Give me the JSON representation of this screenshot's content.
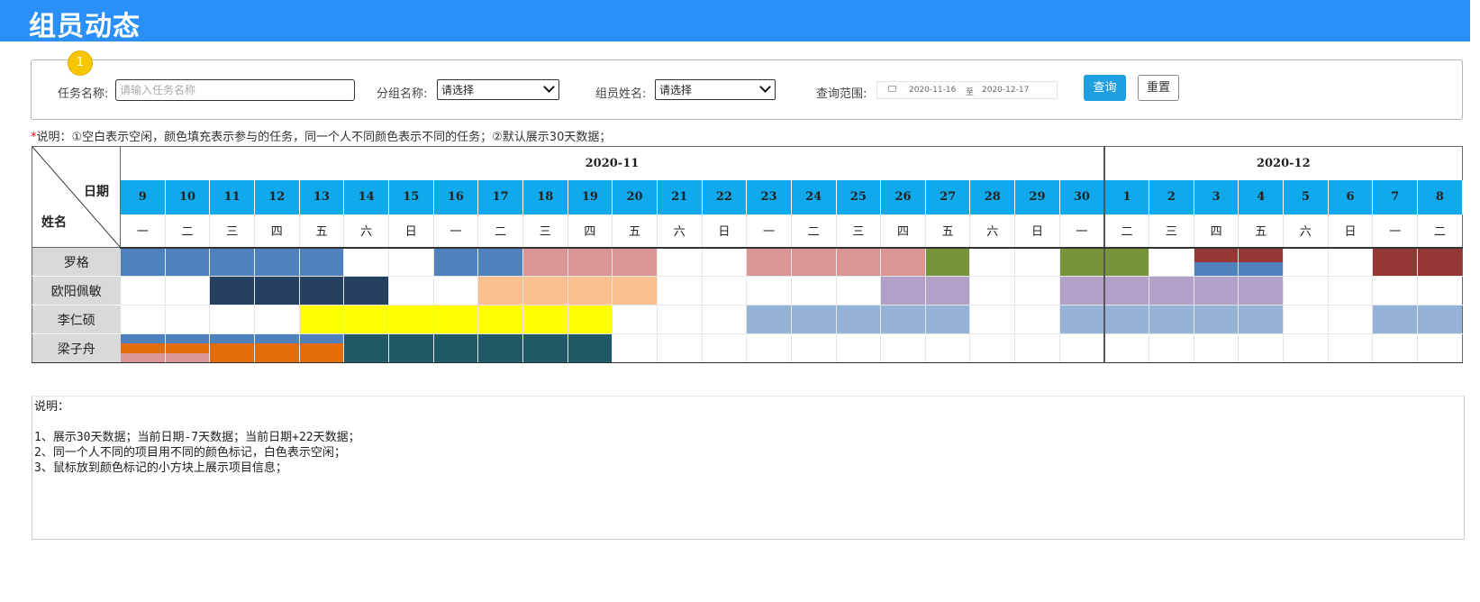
{
  "header": {
    "title": "组员动态"
  },
  "filters": {
    "badge": "1",
    "task_label": "任务名称:",
    "task_placeholder": "请输入任务名称",
    "group_label": "分组名称:",
    "group_value": "请选择",
    "member_label": "组员姓名:",
    "member_value": "请选择",
    "range_label": "查询范围:",
    "range_start": "2020-11-16",
    "range_sep": "至",
    "range_end": "2020-12-17",
    "query_label": "查询",
    "reset_label": "重置"
  },
  "note": {
    "star": "*",
    "text": "说明：①空白表示空闲，颜色填充表示参与的任务，同一个人不同颜色表示不同的任务；②默认展示30天数据；"
  },
  "grid": {
    "corner_date": "日期",
    "corner_name": "姓名",
    "months": [
      {
        "label": "2020-11",
        "span": 22
      },
      {
        "label": "2020-12",
        "span": 8
      }
    ],
    "days": [
      "9",
      "10",
      "11",
      "12",
      "13",
      "14",
      "15",
      "16",
      "17",
      "18",
      "19",
      "20",
      "21",
      "22",
      "23",
      "24",
      "25",
      "26",
      "27",
      "28",
      "29",
      "30",
      "1",
      "2",
      "3",
      "4",
      "5",
      "6",
      "7",
      "8"
    ],
    "weekdays": [
      "一",
      "二",
      "三",
      "四",
      "五",
      "六",
      "日",
      "一",
      "二",
      "三",
      "四",
      "五",
      "六",
      "日",
      "一",
      "二",
      "三",
      "四",
      "五",
      "六",
      "日",
      "一",
      "二",
      "三",
      "四",
      "五",
      "六",
      "日",
      "一",
      "二"
    ],
    "rows": [
      {
        "name": "罗格",
        "tasks": [
          {
            "color": "#4f81bd",
            "start": 0,
            "end": 5,
            "layer": "full"
          },
          {
            "color": "#4f81bd",
            "start": 7,
            "end": 10,
            "layer": "full"
          },
          {
            "color": "#da9694",
            "start": 9,
            "end": 12,
            "layer": "full"
          },
          {
            "color": "#da9694",
            "start": 14,
            "end": 18,
            "layer": "full"
          },
          {
            "color": "#77933c",
            "start": 18,
            "end": 19,
            "layer": "full"
          },
          {
            "color": "#77933c",
            "start": 21,
            "end": 23,
            "layer": "full"
          },
          {
            "color": "#953735",
            "start": 24,
            "end": 26,
            "layer": "top"
          },
          {
            "color": "#4f81bd",
            "start": 24,
            "end": 26,
            "layer": "bottom"
          },
          {
            "color": "#953735",
            "start": 28,
            "end": 30,
            "layer": "full"
          }
        ]
      },
      {
        "name": "欧阳佩敏",
        "tasks": [
          {
            "color": "#254061",
            "start": 2,
            "end": 6,
            "layer": "full"
          },
          {
            "color": "#fac090",
            "start": 8,
            "end": 12,
            "layer": "full"
          },
          {
            "color": "#b1a0c7",
            "start": 17,
            "end": 19,
            "layer": "full"
          },
          {
            "color": "#b1a0c7",
            "start": 21,
            "end": 26,
            "layer": "full"
          }
        ]
      },
      {
        "name": "李仁硕",
        "tasks": [
          {
            "color": "#ffff00",
            "start": 4,
            "end": 11,
            "layer": "full"
          },
          {
            "color": "#95b3d7",
            "start": 14,
            "end": 19,
            "layer": "full"
          },
          {
            "color": "#95b3d7",
            "start": 21,
            "end": 26,
            "layer": "full"
          },
          {
            "color": "#95b3d7",
            "start": 28,
            "end": 30,
            "layer": "full"
          }
        ]
      },
      {
        "name": "梁子舟",
        "tasks": [
          {
            "color": "#4f81bd",
            "start": 0,
            "end": 5,
            "layer": "t1"
          },
          {
            "color": "#e26b0a",
            "start": 0,
            "end": 2,
            "layer": "t2"
          },
          {
            "color": "#da9694",
            "start": 0,
            "end": 2,
            "layer": "t3"
          },
          {
            "color": "#e26b0a",
            "start": 2,
            "end": 5,
            "layer": "t23"
          },
          {
            "color": "#215967",
            "start": 5,
            "end": 11,
            "layer": "full"
          }
        ]
      }
    ]
  },
  "notes": {
    "text": "说明：\n\n1、展示30天数据；当前日期-7天数据；当前日期+22天数据；\n2、同一个人不同的项目用不同的颜色标记，白色表示空闲；\n3、鼠标放到颜色标记的小方块上展示项目信息；"
  }
}
